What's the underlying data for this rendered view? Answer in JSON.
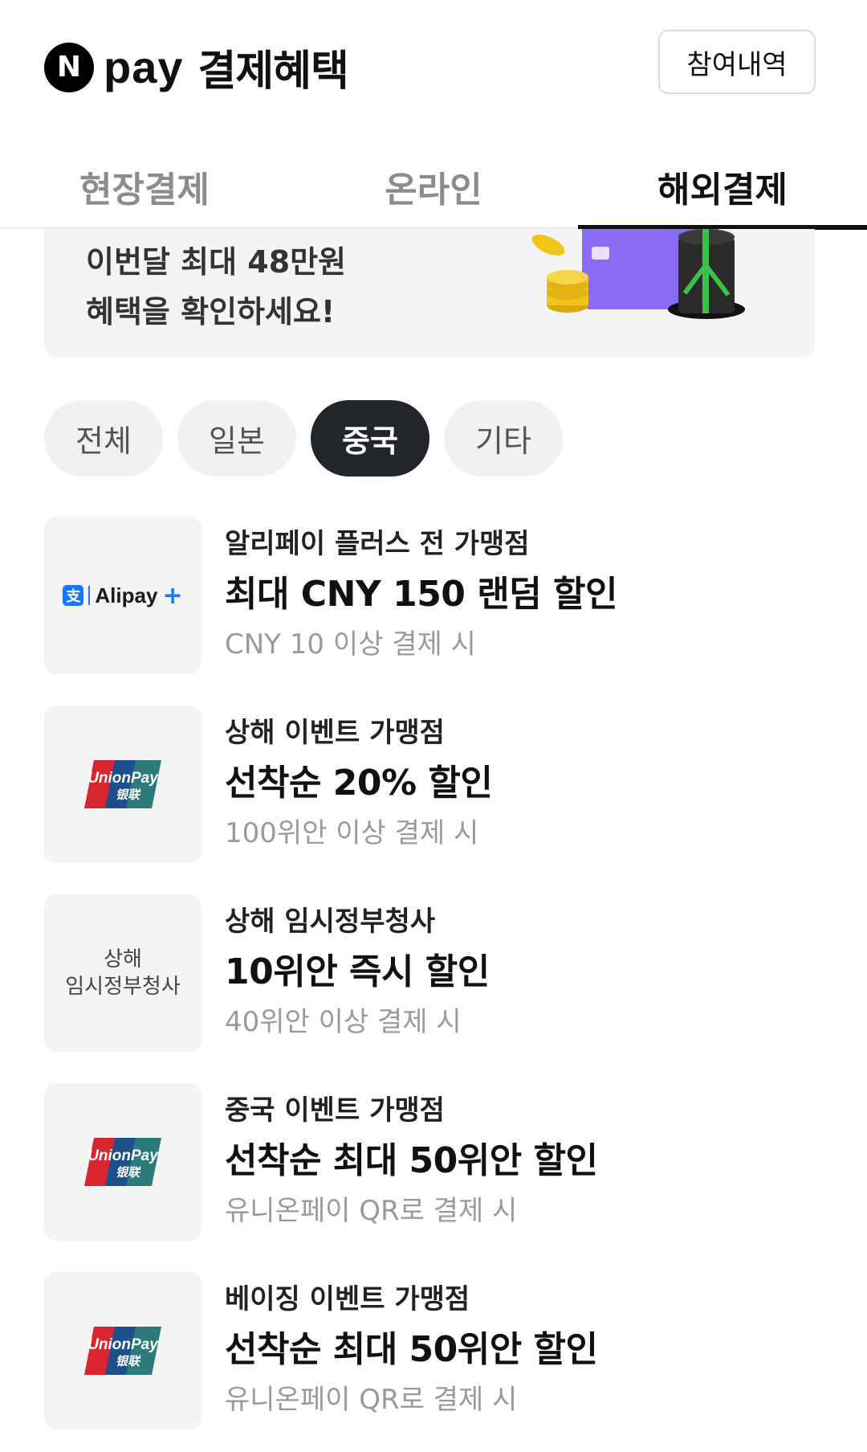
{
  "header": {
    "logo_letter": "N",
    "logo_word": "pay",
    "title": "결제혜택",
    "history_button": "참여내역"
  },
  "tabs": [
    {
      "label": "현장결제",
      "active": false
    },
    {
      "label": "온라인",
      "active": false
    },
    {
      "label": "해외결제",
      "active": true
    }
  ],
  "banner": {
    "line1": "이번달 최대 48만원",
    "line2": "혜택을 확인하세요!",
    "art_icons": [
      "coin-stack-icon",
      "card-icon",
      "gift-box-icon"
    ]
  },
  "chips": [
    {
      "label": "전체",
      "active": false
    },
    {
      "label": "일본",
      "active": false
    },
    {
      "label": "중국",
      "active": true
    },
    {
      "label": "기타",
      "active": false
    }
  ],
  "benefits": [
    {
      "logo": "alipay-plus-logo",
      "logo_text": "Alipay",
      "merchant": "알리페이 플러스 전 가맹점",
      "benefit": "최대 CNY 150 랜덤 할인",
      "condition": "CNY 10 이상 결제 시"
    },
    {
      "logo": "unionpay-logo",
      "logo_text": "UnionPay",
      "logo_subtext": "银联",
      "merchant": "상해 이벤트 가맹점",
      "benefit": "선착순 20% 할인",
      "condition": "100위안 이상 결제 시"
    },
    {
      "logo": "text-logo",
      "logo_line1": "상해",
      "logo_line2": "임시정부청사",
      "merchant": "상해 임시정부청사",
      "benefit": "10위안 즉시 할인",
      "condition": "40위안 이상 결제 시"
    },
    {
      "logo": "unionpay-logo",
      "logo_text": "UnionPay",
      "logo_subtext": "银联",
      "merchant": "중국 이벤트 가맹점",
      "benefit": "선착순 최대 50위안 할인",
      "condition": "유니온페이 QR로 결제 시"
    },
    {
      "logo": "unionpay-logo",
      "logo_text": "UnionPay",
      "logo_subtext": "银联",
      "merchant": "베이징 이벤트 가맹점",
      "benefit": "선착순 최대 50위안 할인",
      "condition": "유니온페이 QR로 결제 시"
    }
  ],
  "colors": {
    "active_chip_bg": "#22262b",
    "unionpay_red": "#d7262e",
    "unionpay_blue": "#1c4f8c",
    "unionpay_teal": "#2b7b7b",
    "alipay_blue": "#1677ff",
    "card_purple": "#8a6bf5",
    "coin_gold": "#f0c419",
    "gift_ribbon": "#39c24a"
  }
}
